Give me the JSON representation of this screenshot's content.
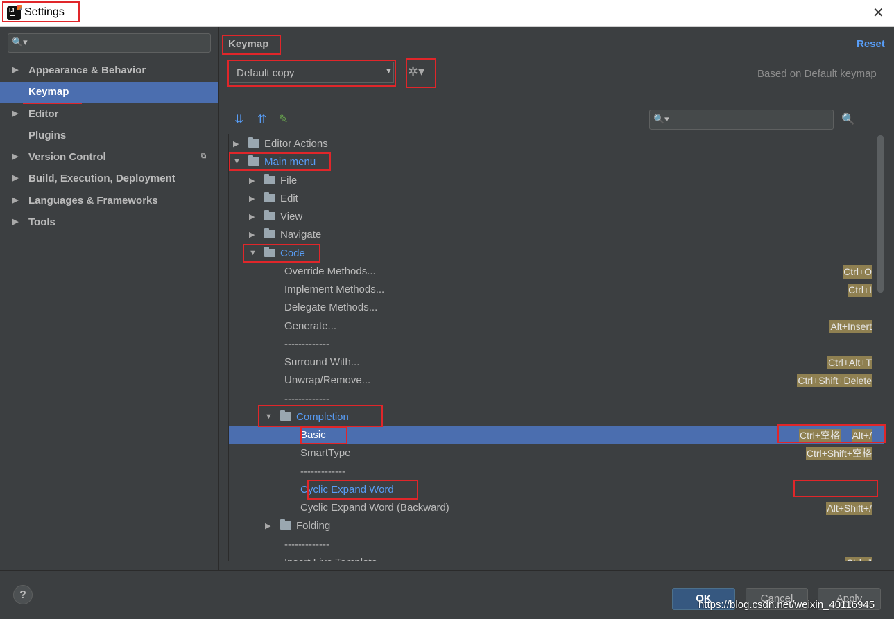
{
  "window": {
    "title": "Settings",
    "close_glyph": "✕"
  },
  "sidebar": {
    "search_icon": "🔍▾",
    "items": [
      {
        "label": "Appearance & Behavior",
        "arrow": "▶"
      },
      {
        "label": "Keymap",
        "arrow": ""
      },
      {
        "label": "Editor",
        "arrow": "▶"
      },
      {
        "label": "Plugins",
        "arrow": ""
      },
      {
        "label": "Version Control",
        "arrow": "▶"
      },
      {
        "label": "Build, Execution, Deployment",
        "arrow": "▶"
      },
      {
        "label": "Languages & Frameworks",
        "arrow": "▶"
      },
      {
        "label": "Tools",
        "arrow": "▶"
      }
    ]
  },
  "keymap": {
    "title": "Keymap",
    "reset": "Reset",
    "selected_keymap": "Default copy",
    "dropdown_glyph": "▼",
    "gear_glyph": "✲▾",
    "based_on": "Based on Default keymap",
    "toolbar": {
      "expand_all": "⇊",
      "collapse_all": "⇈",
      "edit": "✎",
      "search_icon": "🔍▾",
      "find_shortcut": "🔍"
    }
  },
  "tree": {
    "rows": [
      {
        "label": "Editor Actions",
        "arrow": "▶",
        "shortcuts": []
      },
      {
        "label": "Main menu",
        "arrow": "▼",
        "shortcuts": []
      },
      {
        "label": "File",
        "arrow": "▶",
        "shortcuts": []
      },
      {
        "label": "Edit",
        "arrow": "▶",
        "shortcuts": []
      },
      {
        "label": "View",
        "arrow": "▶",
        "shortcuts": []
      },
      {
        "label": "Navigate",
        "arrow": "▶",
        "shortcuts": []
      },
      {
        "label": "Code",
        "arrow": "▼",
        "shortcuts": []
      },
      {
        "label": "Override Methods...",
        "arrow": "",
        "shortcuts": [
          "Ctrl+O"
        ]
      },
      {
        "label": "Implement Methods...",
        "arrow": "",
        "shortcuts": [
          "Ctrl+I"
        ]
      },
      {
        "label": "Delegate Methods...",
        "arrow": "",
        "shortcuts": []
      },
      {
        "label": "Generate...",
        "arrow": "",
        "shortcuts": [
          "Alt+Insert"
        ]
      },
      {
        "label": "-------------",
        "arrow": "",
        "shortcuts": []
      },
      {
        "label": "Surround With...",
        "arrow": "",
        "shortcuts": [
          "Ctrl+Alt+T"
        ]
      },
      {
        "label": "Unwrap/Remove...",
        "arrow": "",
        "shortcuts": [
          "Ctrl+Shift+Delete"
        ]
      },
      {
        "label": "-------------",
        "arrow": "",
        "shortcuts": []
      },
      {
        "label": "Completion",
        "arrow": "▼",
        "shortcuts": []
      },
      {
        "label": "Basic",
        "arrow": "",
        "shortcuts": [
          "Ctrl+空格",
          "Alt+/"
        ]
      },
      {
        "label": "SmartType",
        "arrow": "",
        "shortcuts": [
          "Ctrl+Shift+空格"
        ]
      },
      {
        "label": "-------------",
        "arrow": "",
        "shortcuts": []
      },
      {
        "label": "Cyclic Expand Word",
        "arrow": "",
        "shortcuts": []
      },
      {
        "label": "Cyclic Expand Word (Backward)",
        "arrow": "",
        "shortcuts": [
          "Alt+Shift+/"
        ]
      },
      {
        "label": "Folding",
        "arrow": "▶",
        "shortcuts": []
      },
      {
        "label": "-------------",
        "arrow": "",
        "shortcuts": []
      },
      {
        "label": "Insert Live Template...",
        "arrow": "",
        "shortcuts": [
          "Ctrl+J"
        ]
      }
    ]
  },
  "footer": {
    "help": "?",
    "ok": "OK",
    "cancel": "Cancel",
    "apply": "Apply"
  },
  "watermark": "https://blog.csdn.net/weixin_40116945",
  "colors": {
    "background": "#3c3f41",
    "selection": "#4b6eaf",
    "link": "#589df6",
    "shortcut_badge": "#8f8051",
    "annotation_red": "#e0262a"
  }
}
